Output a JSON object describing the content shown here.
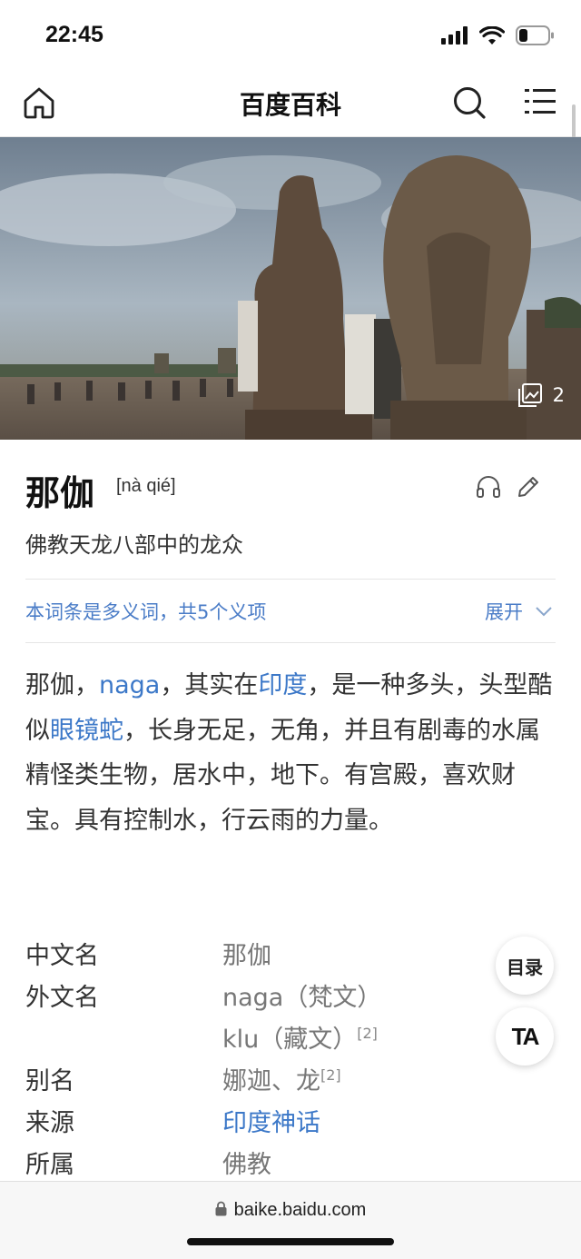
{
  "status_bar": {
    "time": "22:45"
  },
  "nav": {
    "title": "百度百科"
  },
  "hero": {
    "image_count": "2"
  },
  "entry": {
    "title": "那伽",
    "pinyin": "[nà qié]",
    "subtitle": "佛教天龙八部中的龙众"
  },
  "polysemy": {
    "text": "本词条是多义词，共5个义项",
    "expand_label": "展开"
  },
  "summary": {
    "p1": "那伽，",
    "link1": "naga",
    "p2": "，其实在",
    "link2": "印度",
    "p3": "，是一种多头，头型酷似",
    "link3": "眼镜蛇",
    "p4": "，长身无足，无角，并且有剧毒的水属精怪类生物，居水中，地下。有宫殿，喜欢财宝。具有控制水，行云雨的力量。"
  },
  "infobox": [
    {
      "key": "中文名",
      "value": "那伽",
      "sup": ""
    },
    {
      "key": "外文名",
      "value": "naga（梵文）",
      "sup": ""
    },
    {
      "key": "",
      "value": "klu（藏文）",
      "sup": "[2]"
    },
    {
      "key": "别名",
      "value": "娜迦、龙",
      "sup": "[2]"
    },
    {
      "key": "来源",
      "value": "印度神话",
      "sup": ""
    },
    {
      "key": "所属",
      "value": "佛教",
      "sup": ""
    }
  ],
  "fab": {
    "toc_label": "目录",
    "font_label": "TA"
  },
  "browser": {
    "url": "baike.baidu.com"
  },
  "colors": {
    "link": "#3c78c8",
    "polysemy": "#4a7cc7"
  }
}
